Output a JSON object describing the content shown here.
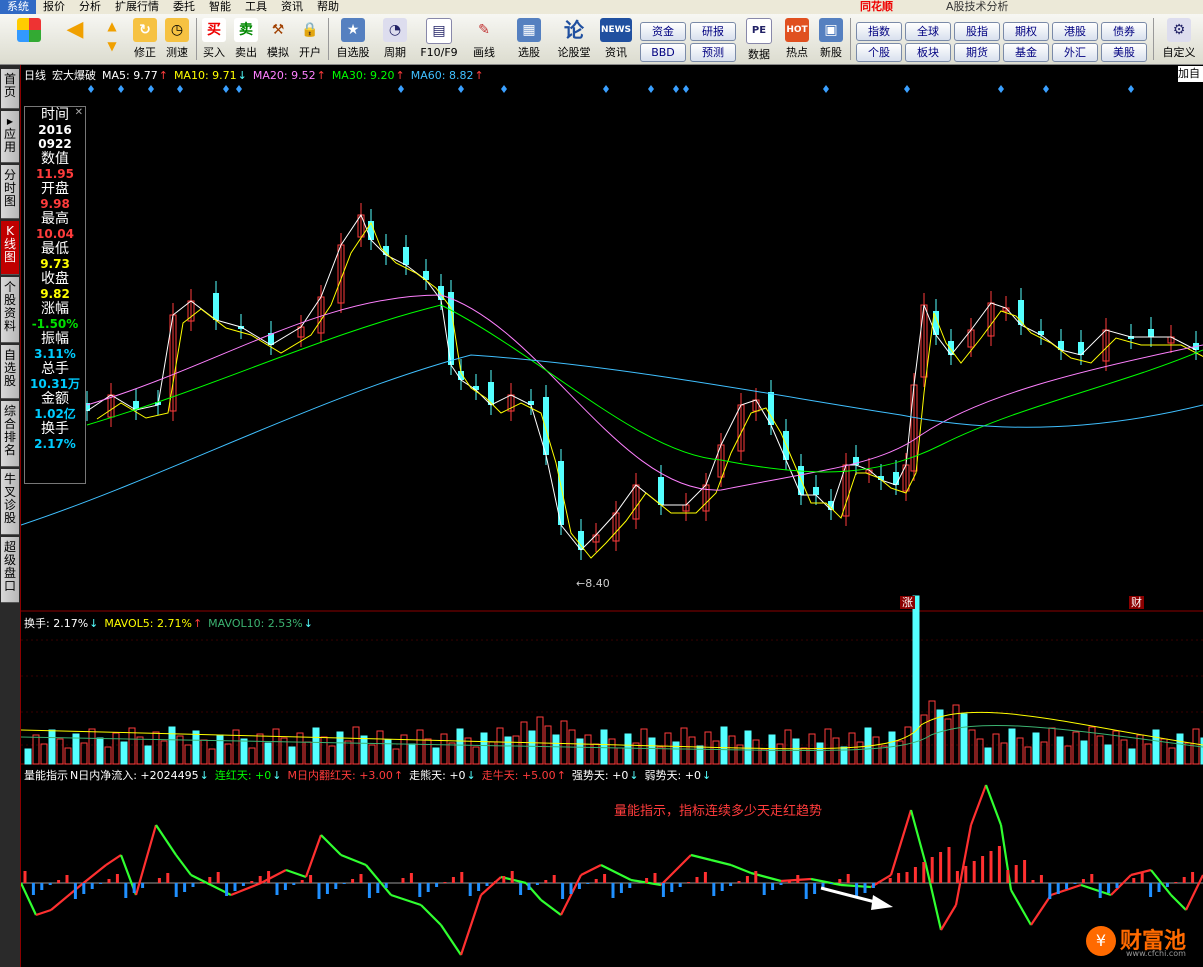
{
  "menu": {
    "items": [
      "系统",
      "报价",
      "分析",
      "扩展行情",
      "委托",
      "智能",
      "工具",
      "资讯",
      "帮助"
    ],
    "logo": "同花顺",
    "window_title": "A股技术分析"
  },
  "toolbar": {
    "buttons": [
      "修正",
      "测速",
      "买入",
      "卖出",
      "模拟",
      "开户",
      "自选股",
      "周期",
      "F10/F9",
      "画线",
      "选股",
      "论股堂",
      "资讯",
      "数据",
      "热点",
      "新股"
    ],
    "small_buttons": [
      [
        "资金",
        "BBD"
      ],
      [
        "研报",
        "预测"
      ]
    ],
    "market_buttons": [
      [
        "指数",
        "个股"
      ],
      [
        "全球",
        "板块"
      ],
      [
        "股指",
        "期货"
      ],
      [
        "期权",
        "基金"
      ],
      [
        "港股",
        "外汇"
      ],
      [
        "债券",
        "美股"
      ]
    ],
    "custom": "自定义"
  },
  "sidebar": [
    "首页",
    "应用",
    "分时图",
    "K线图",
    "个股资料",
    "自选股",
    "综合排名",
    "牛叉诊股",
    "超级盘口"
  ],
  "main_header": {
    "period": "日线",
    "name": "宏大爆破",
    "ma5": "MA5: 9.77",
    "ma10": "MA10: 9.71",
    "ma20": "MA20: 9.52",
    "ma30": "MA30: 9.20",
    "ma60": "MA60: 8.82",
    "right_tag": "加自"
  },
  "info_panel": [
    {
      "label": "时间",
      "value": "2016",
      "value2": "0922",
      "color": "#ffffff"
    },
    {
      "label": "数值",
      "value": "11.95",
      "color": "#ff3c3c"
    },
    {
      "label": "开盘",
      "value": "9.98",
      "color": "#ff3c3c"
    },
    {
      "label": "最高",
      "value": "10.04",
      "color": "#ff3c3c"
    },
    {
      "label": "最低",
      "value": "9.73",
      "color": "#ffff00"
    },
    {
      "label": "收盘",
      "value": "9.82",
      "color": "#ffff00"
    },
    {
      "label": "涨幅",
      "value": "-1.50%",
      "color": "#00e000"
    },
    {
      "label": "振幅",
      "value": "3.11%",
      "color": "#00ccff"
    },
    {
      "label": "总手",
      "value": "10.31万",
      "color": "#00ccff"
    },
    {
      "label": "金额",
      "value": "1.02亿",
      "color": "#00ccff"
    },
    {
      "label": "换手",
      "value": "2.17%",
      "color": "#00ccff"
    }
  ],
  "low_label": "8.40",
  "markers": {
    "zhang": "涨",
    "cai": "财"
  },
  "vol_header": {
    "hs": "换手: 2.17%",
    "mavol5": "MAVOL5: 2.71%",
    "mavol10": "MAVOL10: 2.53%"
  },
  "ind_header": {
    "title": "量能指示",
    "n_in": "N日内净流入: +2024495",
    "lianhong": "连红天: +0",
    "m_fan": "M日内翻红天: +3.00",
    "zoumao": "走熊天: +0",
    "zouniu": "走牛天: +5.00",
    "qiang": "强势天: +0",
    "ruo": "弱势天: +0"
  },
  "annotation": "量能指示，指标连续多少天走红趋势",
  "watermark": {
    "name": "财富池",
    "url": "www.cfchi.com"
  },
  "colors": {
    "up": "#ff3c3c",
    "down": "#54ffff",
    "ma5": "#ffffff",
    "ma10": "#ffff00",
    "ma20": "#ff80ff",
    "ma30": "#00ff00",
    "ma60": "#40c0ff"
  }
}
